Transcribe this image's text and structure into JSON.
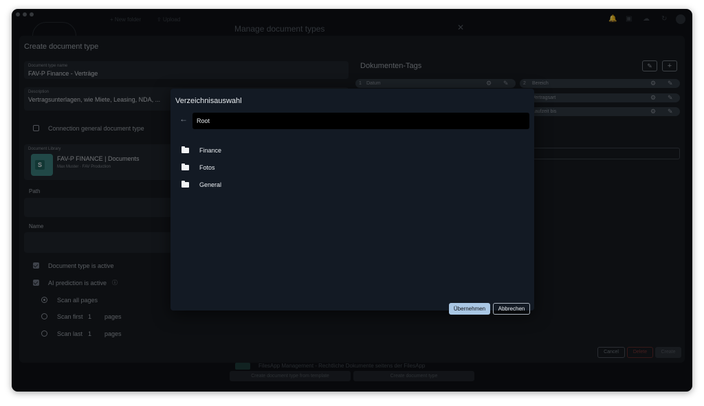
{
  "toolbar": {
    "new_folder": "New folder",
    "upload": "Upload"
  },
  "manage_dialog": {
    "title": "Manage document types"
  },
  "create_form": {
    "title": "Create document type",
    "doc_type_name_label": "Document type name",
    "doc_type_name_value": "FAV-P Finance - Verträge",
    "description_label": "Description",
    "description_value": "Vertragsunterlagen, wie Miete, Leasing, NDA, ...",
    "connection_general_label": "Connection general document type",
    "library_label": "Document Library",
    "library_name": "FAV-P FINANCE | Documents",
    "library_sub": "Max Muster · FAV Production",
    "path_label": "Path",
    "name_label": "Name",
    "doc_type_active_label": "Document type is active",
    "ai_prediction_label": "AI prediction is active",
    "scan_all_label": "Scan all pages",
    "scan_first_label": "Scan first",
    "scan_first_value": "1",
    "scan_last_label": "Scan last",
    "scan_last_value": "1",
    "pages_label": "pages"
  },
  "tags": {
    "title": "Dokumenten-Tags",
    "items": [
      {
        "num": "1",
        "label": "Datum"
      },
      {
        "num": "2",
        "label": "Bereich"
      },
      {
        "num": "",
        "label": "Vertragsart"
      },
      {
        "num": "",
        "label": "Laufzeit bis"
      }
    ]
  },
  "form_actions": {
    "cancel": "Cancel",
    "delete": "Delete",
    "create": "Create"
  },
  "bottom_bar": {
    "template_text": "FilesApp Management - Rechtliche Dokumente seitens der FilesApp",
    "from_template_button": "Create document type from template",
    "create_button": "Create document type"
  },
  "dir_dialog": {
    "title": "Verzeichnisauswahl",
    "path": "Root",
    "folders": [
      "Finance",
      "Fotos",
      "General"
    ],
    "apply_button": "Übernehmen",
    "cancel_button": "Abbrechen"
  },
  "colors": {
    "accent": "#a9c7e4",
    "dialog_bg": "#131a24",
    "delete": "#c0392b"
  }
}
